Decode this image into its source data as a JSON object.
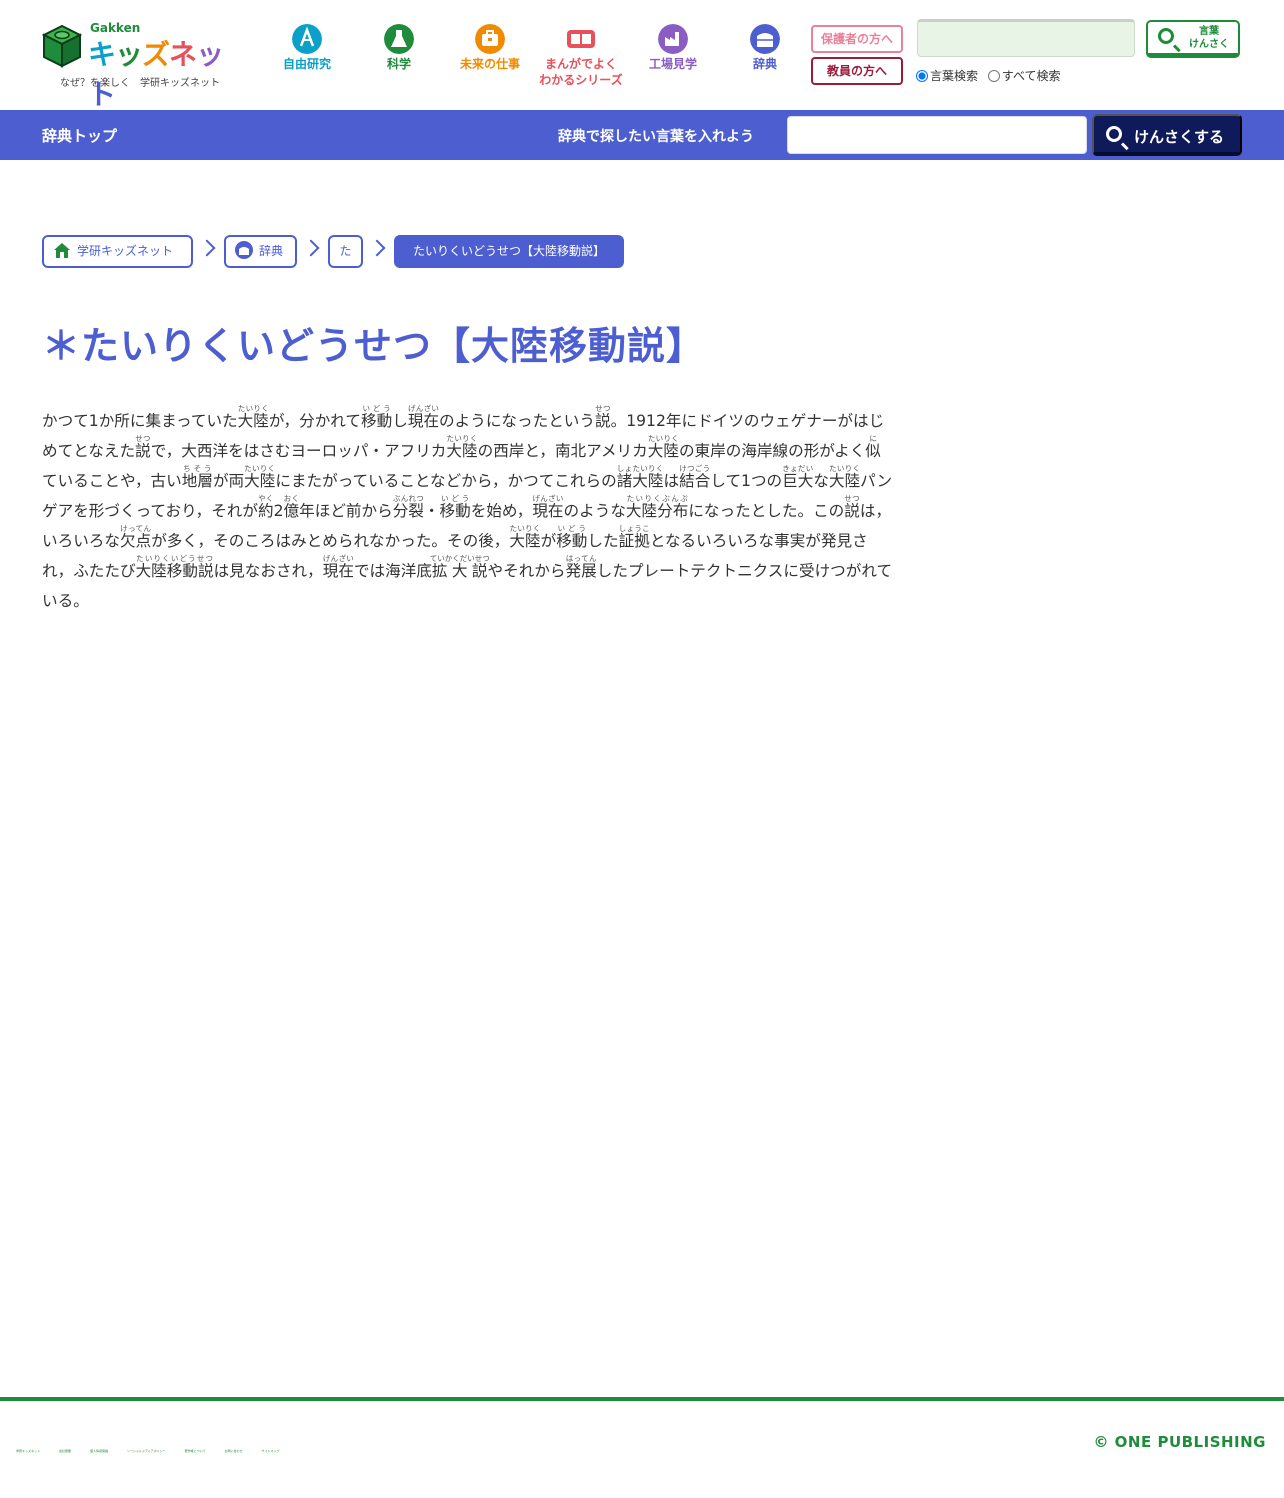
{
  "header": {
    "logo": {
      "brand_small": "Gakken",
      "brand_parts": [
        "キ",
        "ッ",
        "ズ",
        "ネ",
        "ッ",
        "ト"
      ],
      "tagline": "なぜ？を楽しく　学研キッズネット"
    },
    "nav": [
      {
        "label": "自由研究",
        "color": "#0aa0c8",
        "icon": "research-icon"
      },
      {
        "label": "科学",
        "color": "#1e8c3a",
        "icon": "flask-icon"
      },
      {
        "label": "未来の仕事",
        "color": "#f08a00",
        "icon": "briefcase-icon"
      },
      {
        "label_line1": "まんがでよく",
        "label_line2": "わかるシリーズ",
        "color": "#e8505b",
        "icon": "book-icon"
      },
      {
        "label": "工場見学",
        "color": "#8b5cc4",
        "icon": "factory-icon"
      },
      {
        "label": "辞典",
        "color": "#4d5fd0",
        "icon": "dictionary-icon"
      }
    ],
    "parents_label": "保護者の方へ",
    "teachers_label": "教員の方へ",
    "search": {
      "value": "",
      "button_line1": "言葉",
      "button_line2": "けんさく",
      "radio_words": "言葉検索",
      "radio_all": "すべて検索",
      "selected": "言葉検索"
    }
  },
  "dict_bar": {
    "top_link": "辞典トップ",
    "prompt": "辞典で探したい言葉を入れよう",
    "input_value": "",
    "button_label": "けんさくする"
  },
  "breadcrumb": [
    {
      "label": "学研キッズネット",
      "icon": "home-icon"
    },
    {
      "label": "辞典",
      "icon": "dictionary-icon"
    },
    {
      "label": "た"
    },
    {
      "label": "たいりくいどうせつ【大陸移動説】"
    }
  ],
  "entry": {
    "title": "＊たいりくいどうせつ【大陸移動説】",
    "segments": [
      {
        "t": "かつて1か所に集まっていた"
      },
      {
        "r": "大陸",
        "f": "たいりく"
      },
      {
        "t": "が，分かれて"
      },
      {
        "r": "移動",
        "f": "いどう"
      },
      {
        "t": "し"
      },
      {
        "r": "現在",
        "f": "げんざい"
      },
      {
        "t": "のようになったという"
      },
      {
        "r": "説",
        "f": "せつ"
      },
      {
        "t": "。1912年にドイツのウェゲナーがはじめてとなえた"
      },
      {
        "r": "説",
        "f": "せつ"
      },
      {
        "t": "で，大西洋をはさむヨーロッパ・アフリカ"
      },
      {
        "r": "大陸",
        "f": "たいりく"
      },
      {
        "t": "の西岸と，南北アメリカ"
      },
      {
        "r": "大陸",
        "f": "たいりく"
      },
      {
        "t": "の東岸の海岸線の形がよく"
      },
      {
        "r": "似",
        "f": "に"
      },
      {
        "t": "ていることや，古い"
      },
      {
        "r": "地層",
        "f": "ちそう"
      },
      {
        "t": "が両"
      },
      {
        "r": "大陸",
        "f": "たいりく"
      },
      {
        "t": "にまたがっていることなどから，かつてこれらの"
      },
      {
        "r": "諸大陸",
        "f": "しょたいりく"
      },
      {
        "t": "は"
      },
      {
        "r": "結合",
        "f": "けつごう"
      },
      {
        "t": "して1つの"
      },
      {
        "r": "巨大",
        "f": "きょだい"
      },
      {
        "t": "な"
      },
      {
        "r": "大陸",
        "f": "たいりく"
      },
      {
        "t": "パンゲアを形づくっており，それが"
      },
      {
        "r": "約",
        "f": "やく"
      },
      {
        "t": "2"
      },
      {
        "r": "億",
        "f": "おく"
      },
      {
        "t": "年ほど前から"
      },
      {
        "r": "分裂",
        "f": "ぶんれつ"
      },
      {
        "t": "・"
      },
      {
        "r": "移動",
        "f": "いどう"
      },
      {
        "t": "を始め，"
      },
      {
        "r": "現在",
        "f": "げんざい"
      },
      {
        "t": "のような"
      },
      {
        "r": "大陸分布",
        "f": "たいりくぶんぷ"
      },
      {
        "t": "になったとした。この"
      },
      {
        "r": "説",
        "f": "せつ"
      },
      {
        "t": "は，いろいろな"
      },
      {
        "r": "欠点",
        "f": "けってん"
      },
      {
        "t": "が多く，そのころはみとめられなかった。その後，"
      },
      {
        "r": "大陸",
        "f": "たいりく"
      },
      {
        "t": "が"
      },
      {
        "r": "移動",
        "f": "いどう"
      },
      {
        "t": "した"
      },
      {
        "r": "証拠",
        "f": "しょうこ"
      },
      {
        "t": "となるいろいろな事実が発見され，ふたたび"
      },
      {
        "r": "大陸移動説",
        "f": "たいりくいどうせつ"
      },
      {
        "t": "は見なおされ，"
      },
      {
        "r": "現在",
        "f": "げんざい"
      },
      {
        "t": "では海洋底"
      },
      {
        "r": "拡大説",
        "f": "ていかくだいせつ"
      },
      {
        "t": "やそれから"
      },
      {
        "r": "発展",
        "f": "はってん"
      },
      {
        "t": "したプレートテクトニクスに受けつがれている。"
      }
    ]
  },
  "footer": {
    "links": [
      "学研キッズネット",
      "会社概要",
      "個人情報保護",
      "ソーシャルメディアポリシー",
      "著作権について",
      "お問い合わせ",
      "サイトマップ"
    ],
    "copyright": "© ONE PUBLISHING"
  },
  "colors": {
    "accent": "#4d5fd0",
    "brand_green": "#1e8c3a",
    "button_navy": "#0f1a5a"
  }
}
